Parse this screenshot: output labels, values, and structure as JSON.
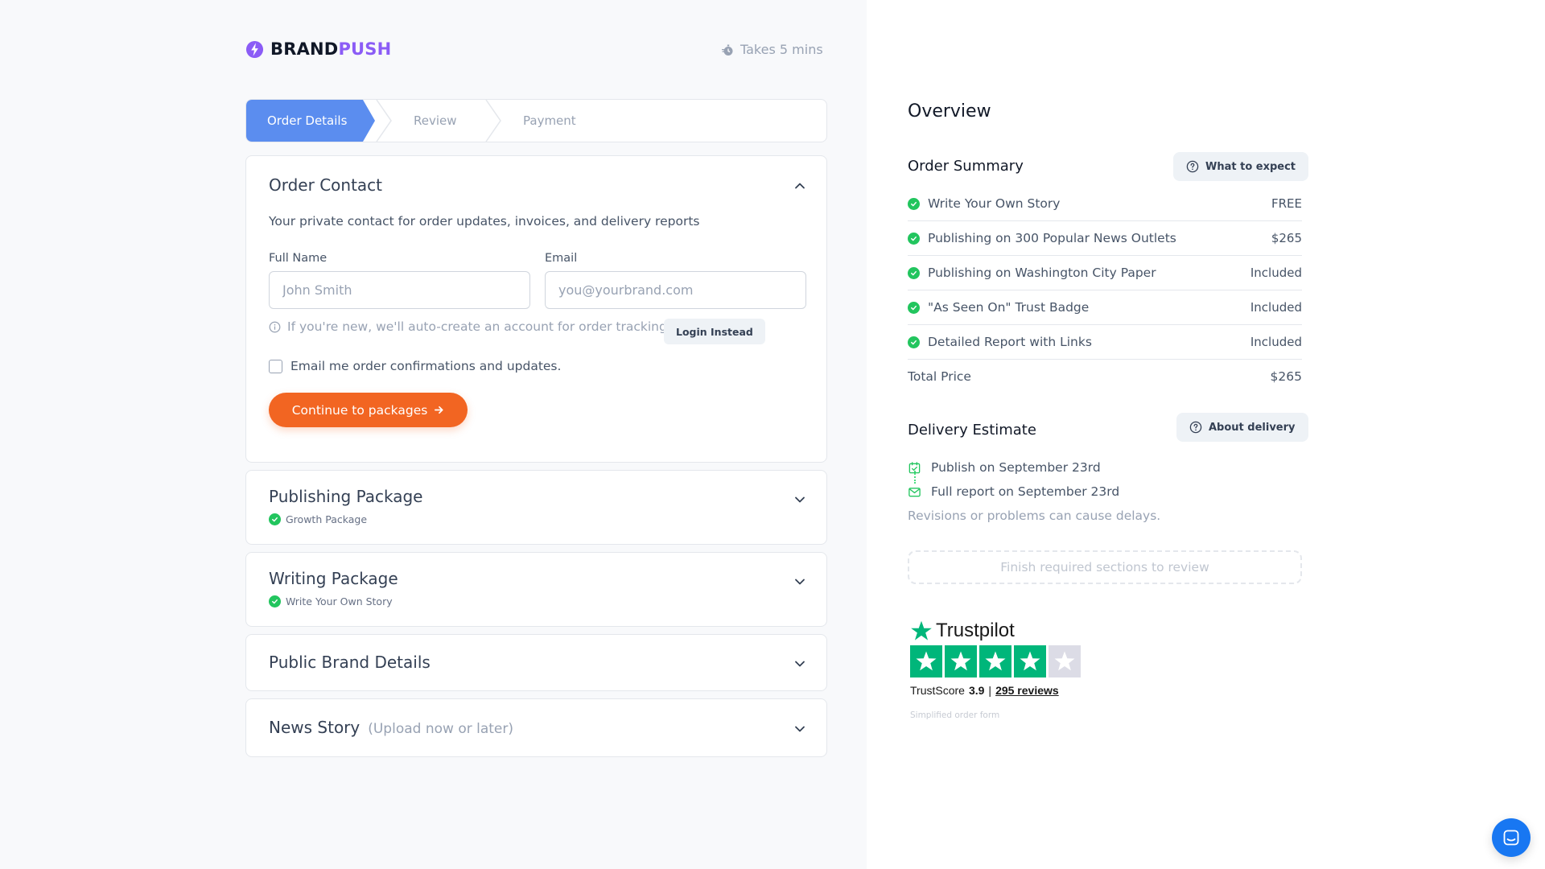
{
  "brand": {
    "name_part1": "BRAND",
    "name_part2": "PUSH",
    "accent_color": "#8b5cf6"
  },
  "header": {
    "takes": "Takes 5 mins"
  },
  "stepper": {
    "steps": [
      "Order Details",
      "Review",
      "Payment"
    ],
    "active_index": 0,
    "active_color": "#5b8def"
  },
  "order_contact": {
    "title": "Order Contact",
    "description": "Your private contact for order updates, invoices, and delivery reports",
    "full_name_label": "Full Name",
    "full_name_placeholder": "John Smith",
    "email_label": "Email",
    "email_placeholder": "you@yourbrand.com",
    "info_text": "If you're new, we'll auto-create an account for order tracking.",
    "login_button": "Login Instead",
    "checkbox_label": "Email me order confirmations and updates.",
    "checkbox_checked": false,
    "continue_button": "Continue to packages",
    "cta_color": "#f26522"
  },
  "sections": {
    "publishing": {
      "title": "Publishing Package",
      "selected": "Growth Package"
    },
    "writing": {
      "title": "Writing Package",
      "selected": "Write Your Own Story"
    },
    "brand_details": {
      "title": "Public Brand Details"
    },
    "news_story": {
      "title": "News Story",
      "hint": "(Upload now or later)"
    }
  },
  "overview": {
    "title": "Overview",
    "order_summary_title": "Order Summary",
    "what_to_expect_button": "What to expect",
    "items": [
      {
        "label": "Write Your Own Story",
        "price": "FREE"
      },
      {
        "label": "Publishing on 300 Popular News Outlets",
        "price": "$265"
      },
      {
        "label": "Publishing on Washington City Paper",
        "price": "Included"
      },
      {
        "label": "\"As Seen On\" Trust Badge",
        "price": "Included"
      },
      {
        "label": "Detailed Report with Links",
        "price": "Included"
      }
    ],
    "total_label": "Total Price",
    "total_value": "$265",
    "delivery_title": "Delivery Estimate",
    "about_delivery_button": "About delivery",
    "publish_date": "Publish on September 23rd",
    "report_date": "Full report on September 23rd",
    "delivery_note": "Revisions or problems can cause delays.",
    "finish_button": "Finish required sections to review"
  },
  "trustpilot": {
    "brand": "Trustpilot",
    "trustscore_label": "TrustScore",
    "score": "3.9",
    "separator": "|",
    "reviews": "295 reviews",
    "filled_stars": 4,
    "total_stars": 5,
    "green": "#00b67a"
  },
  "footer_note": "Simplified order form",
  "icons": {
    "logo": "brandpush-logo-icon",
    "timer": "stopwatch-icon",
    "info": "info-circle-icon",
    "help": "question-circle-icon",
    "check": "check-circle-icon",
    "chevron_up": "chevron-up-icon",
    "chevron_down": "chevron-down-icon",
    "arrow_right": "arrow-right-icon",
    "calendar": "calendar-check-icon",
    "mail": "mail-icon",
    "chat": "chat-icon",
    "star": "star-icon"
  }
}
